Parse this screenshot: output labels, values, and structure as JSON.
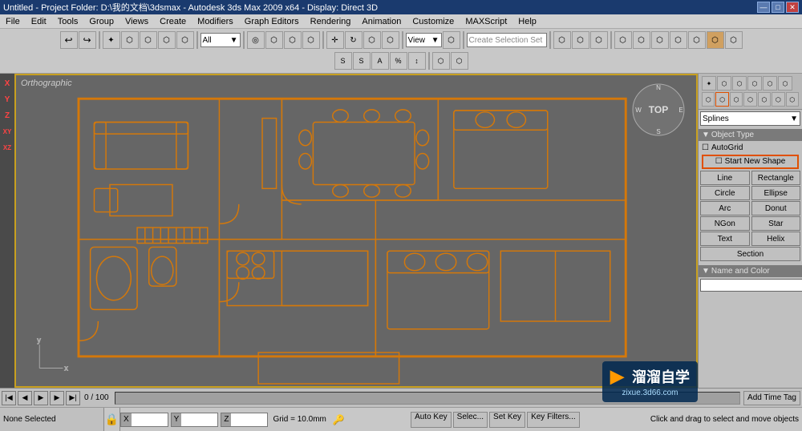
{
  "titlebar": {
    "title": "Untitled - Project Folder: D:\\我的文档\\3dsmax - Autodesk 3ds Max 2009 x64 - Display: Direct 3D",
    "min_label": "—",
    "max_label": "□",
    "close_label": "✕"
  },
  "menubar": {
    "items": [
      "File",
      "Edit",
      "Tools",
      "Group",
      "Views",
      "Create",
      "Modifiers",
      "Graph Editors",
      "Rendering",
      "Animation",
      "Customize",
      "MAXScript",
      "Help"
    ]
  },
  "toolbar": {
    "row1_icons": [
      "↩",
      "⟲",
      "✦",
      "◉",
      "⬡",
      "⬡",
      "⬡",
      "✦",
      "⬡",
      "⬡",
      "⬡",
      "⬡",
      "⬡",
      "⬡",
      "⬡"
    ],
    "dropdown_all": "All",
    "dropdown_view": "View",
    "create_selection_set": "Create Selection Set",
    "row2_icons": [
      "⬡",
      "⬡",
      "⬡",
      "⬡",
      "⬡",
      "⬡",
      "⬡",
      "⬡",
      "⬡",
      "⬡",
      "⬡",
      "⬡",
      "⬡",
      "⬡",
      "⬡",
      "⬡",
      "⬡",
      "⬡",
      "⬡",
      "⬡",
      "⬡"
    ]
  },
  "viewport": {
    "label": "Orthographic",
    "top_label": "TOP",
    "border_color": "#c8a020"
  },
  "left_axis": {
    "labels": [
      "X",
      "Y",
      "Z",
      "XY",
      "XZ"
    ]
  },
  "right_panel": {
    "dropdown": "Splines",
    "section_object_type": "Object Type",
    "autocomplete_label": "AutoGrid",
    "start_new_shape_label": "Start New Shape",
    "buttons": [
      {
        "label": "Line",
        "col": 1
      },
      {
        "label": "Rectangle",
        "col": 2
      },
      {
        "label": "Circle",
        "col": 1
      },
      {
        "label": "Ellipse",
        "col": 2
      },
      {
        "label": "Arc",
        "col": 1
      },
      {
        "label": "Donut",
        "col": 2
      },
      {
        "label": "NGon",
        "col": 1
      },
      {
        "label": "Star",
        "col": 2
      },
      {
        "label": "Text",
        "col": 1
      },
      {
        "label": "Helix",
        "col": 2
      },
      {
        "label": "Section",
        "col": 1
      }
    ],
    "section_name_color": "Name and Color",
    "name_placeholder": ""
  },
  "timeline": {
    "frame_display": "0 / 100",
    "add_time_tag": "Add Time Tag"
  },
  "statusbar": {
    "selection": "None Selected",
    "message": "Click and drag to select and move objects",
    "x_val": "",
    "y_val": "",
    "z_val": "",
    "grid_label": "Grid = 10.0mm",
    "auto_key": "Auto Key",
    "set_key": "Set Key",
    "key_filters": "Key Filters...",
    "selection_right": "Selec..."
  },
  "watermark": {
    "logo": "▶",
    "brand": "溜溜自学",
    "url": "zixue.3d66.com"
  },
  "icons": {
    "minimize": "—",
    "maximize": "□",
    "close": "✕",
    "lock": "🔒",
    "key": "🔑",
    "dropdown_arrow": "▼",
    "checkbox_unchecked": "☐",
    "checkbox_checked": "☑",
    "play": "▶",
    "prev": "◀",
    "next": "▶",
    "first": "◀◀",
    "last": "▶▶"
  }
}
